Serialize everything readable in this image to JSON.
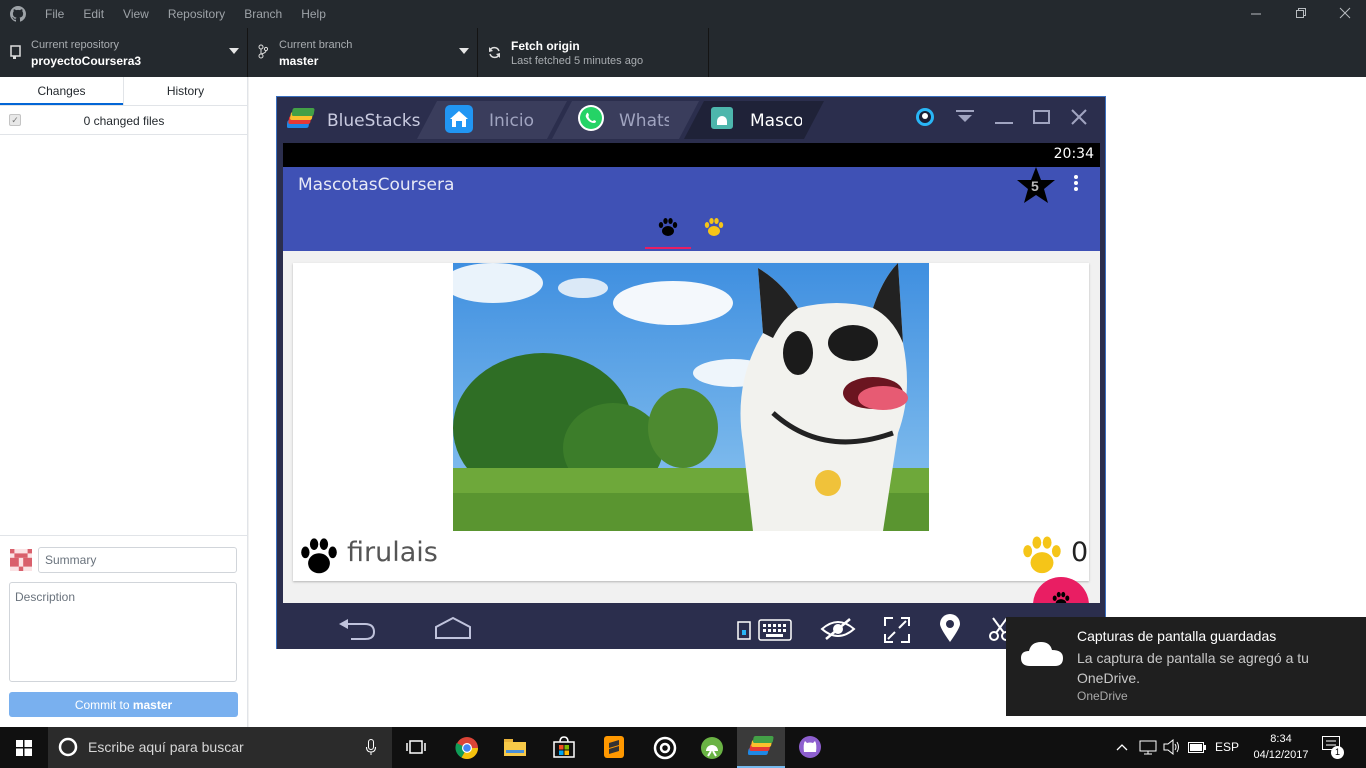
{
  "app_menu": [
    "File",
    "Edit",
    "View",
    "Repository",
    "Branch",
    "Help"
  ],
  "toolbar": {
    "repo_label": "Current repository",
    "repo_value": "proyectoCoursera3",
    "branch_label": "Current branch",
    "branch_value": "master",
    "fetch_label": "Fetch origin",
    "fetch_sub": "Last fetched 5 minutes ago"
  },
  "sidebar": {
    "tab_changes": "Changes",
    "tab_history": "History",
    "changed_files": "0 changed files",
    "summary_placeholder": "Summary",
    "description_placeholder": "Description",
    "commit_prefix": "Commit to ",
    "commit_branch": "master"
  },
  "bluestacks": {
    "brand": "BlueStacks",
    "tabs": [
      "Inicio",
      "WhatsApp",
      "MascotasCoursera"
    ],
    "clock": "20:34",
    "app_title": "MascotasCoursera",
    "star_badge": "5",
    "pet_name": "firulais",
    "likes": "0"
  },
  "toast": {
    "title": "Capturas de pantalla guardadas",
    "body": "La captura de pantalla se agregó a tu OneDrive.",
    "source": "OneDrive"
  },
  "taskbar": {
    "search_placeholder": "Escribe aquí para buscar",
    "language": "ESP",
    "time": "8:34",
    "date": "04/12/2017",
    "notifications": "1"
  },
  "colors": {
    "accent_blue": "#0366d6",
    "android_primary": "#3f51b5",
    "fab_pink": "#e91e63",
    "paw_yellow": "#f5c518"
  }
}
